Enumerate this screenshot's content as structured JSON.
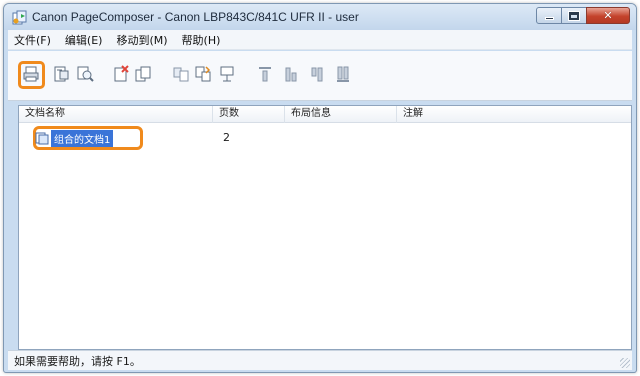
{
  "window": {
    "title": "Canon PageComposer - Canon LBP843C/841C UFR II - user"
  },
  "menubar": {
    "items": [
      {
        "label": "文件(F)"
      },
      {
        "label": "编辑(E)"
      },
      {
        "label": "移动到(M)"
      },
      {
        "label": "帮助(H)"
      }
    ]
  },
  "toolbar": {
    "icons": [
      "print-icon",
      "page-setup-icon",
      "preview-icon",
      "delete-icon",
      "copy-icon",
      "merge-icon",
      "combine-icon",
      "split-icon",
      "move-top-icon",
      "move-up-icon",
      "move-down-icon",
      "move-bottom-icon"
    ],
    "highlight_color": "#f08a1c"
  },
  "list": {
    "columns": [
      "文档名称",
      "页数",
      "布局信息",
      "注解"
    ],
    "rows": [
      {
        "name": "组合的文档1",
        "pages": "2",
        "layout": "",
        "notes": ""
      }
    ]
  },
  "status": {
    "text": "如果需要帮助，请按 F1。"
  }
}
